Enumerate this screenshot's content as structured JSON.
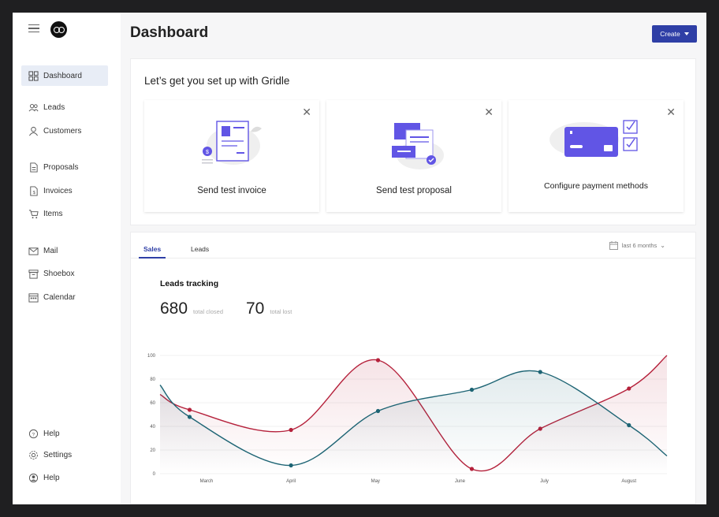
{
  "sidebar": {
    "groups": [
      [
        {
          "label": "Dashboard",
          "icon": "dashboard-icon",
          "active": true
        }
      ],
      [
        {
          "label": "Leads",
          "icon": "leads-icon"
        },
        {
          "label": "Customers",
          "icon": "customers-icon"
        }
      ],
      [
        {
          "label": "Proposals",
          "icon": "proposals-icon"
        },
        {
          "label": "Invoices",
          "icon": "invoices-icon"
        },
        {
          "label": "Items",
          "icon": "cart-icon"
        }
      ],
      [
        {
          "label": "Mail",
          "icon": "mail-icon"
        },
        {
          "label": "Shoebox",
          "icon": "shoebox-icon"
        },
        {
          "label": "Calendar",
          "icon": "calendar-icon"
        }
      ]
    ],
    "bottom": [
      {
        "label": "Help",
        "icon": "help-icon"
      },
      {
        "label": "Settings",
        "icon": "settings-icon"
      },
      {
        "label": "Help",
        "icon": "user-icon"
      }
    ]
  },
  "header": {
    "title": "Dashboard",
    "create_label": "Create"
  },
  "setup": {
    "title": "Let’s get you set up with Gridle",
    "cards": [
      {
        "label": "Send test invoice"
      },
      {
        "label": "Send test proposal"
      },
      {
        "label": "Configure payment methods"
      }
    ]
  },
  "tabs": {
    "sales": "Sales",
    "leads": "Leads",
    "range": "last 6 months"
  },
  "leads_tracking": {
    "title": "Leads tracking",
    "closed_value": "680",
    "closed_caption": "total closed",
    "lost_value": "70",
    "lost_caption": "total lost"
  },
  "colors": {
    "accent": "#2f3fa6",
    "series_red": "#b5213b",
    "series_teal": "#1d6474",
    "illustration": "#6155e5"
  },
  "chart_data": {
    "type": "line",
    "x_labels": [
      "March",
      "April",
      "May",
      "June",
      "July",
      "August"
    ],
    "y_ticks": [
      0,
      20,
      40,
      60,
      80,
      100
    ],
    "ylim": [
      0,
      100
    ],
    "grid": true,
    "series": [
      {
        "color": "#b5213b",
        "points": [
          [
            0.0,
            67
          ],
          [
            0.35,
            54
          ],
          [
            1.55,
            37
          ],
          [
            2.58,
            96
          ],
          [
            3.69,
            4
          ],
          [
            4.5,
            38
          ],
          [
            5.55,
            72
          ],
          [
            6.0,
            100
          ]
        ]
      },
      {
        "color": "#1d6474",
        "points": [
          [
            0.0,
            75
          ],
          [
            0.35,
            48
          ],
          [
            1.55,
            7
          ],
          [
            2.58,
            53
          ],
          [
            3.69,
            71
          ],
          [
            4.5,
            86
          ],
          [
            5.55,
            41
          ],
          [
            6.0,
            15
          ]
        ]
      }
    ]
  }
}
